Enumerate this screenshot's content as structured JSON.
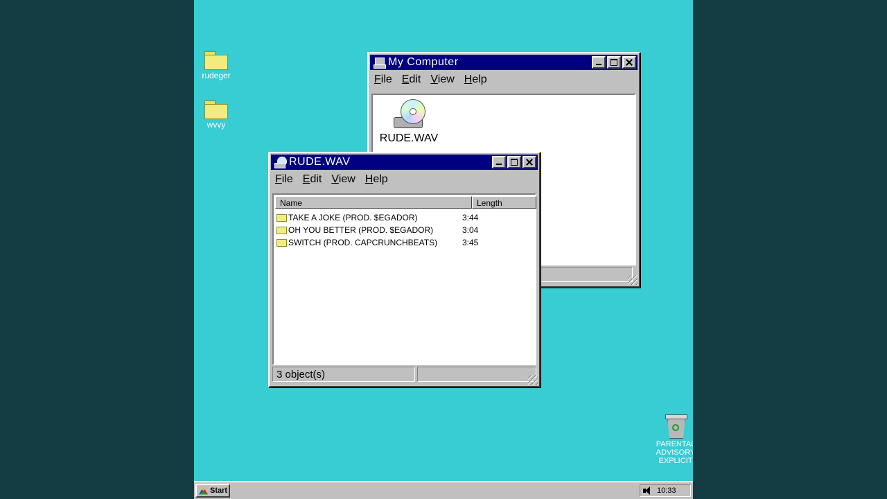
{
  "desktop": {
    "icons": [
      {
        "label": "rudeger"
      },
      {
        "label": "wvvy"
      }
    ],
    "bin_label_lines": [
      "PARENTAL",
      "ADVISORY",
      "EXPLICIT"
    ]
  },
  "mycomputer": {
    "title": "My Computer",
    "menu": [
      "File",
      "Edit",
      "View",
      "Help"
    ],
    "drive_label": "RUDE.WAV"
  },
  "rudewav": {
    "title": "RUDE.WAV",
    "menu": [
      "File",
      "Edit",
      "View",
      "Help"
    ],
    "columns": [
      "Name",
      "Length"
    ],
    "rows": [
      {
        "name": "TAKE A JOKE (PROD. $EGADOR)",
        "length": "3:44"
      },
      {
        "name": "OH YOU BETTER (PROD. $EGADOR)",
        "length": "3:04"
      },
      {
        "name": "SWITCH (PROD. CAPCRUNCHBEATS)",
        "length": "3:45"
      }
    ],
    "status": "3 object(s)"
  },
  "taskbar": {
    "start_label": "Start",
    "clock": "10:33"
  },
  "colors": {
    "desktop": "#38ccd3",
    "titlebar": "#000080",
    "chrome": "#c0c0c0",
    "outer": "#133d42"
  },
  "icons": [
    "folder-icon",
    "computer-icon",
    "cd-drive-icon",
    "recycle-bin-icon",
    "windows-logo-icon",
    "speaker-icon"
  ]
}
